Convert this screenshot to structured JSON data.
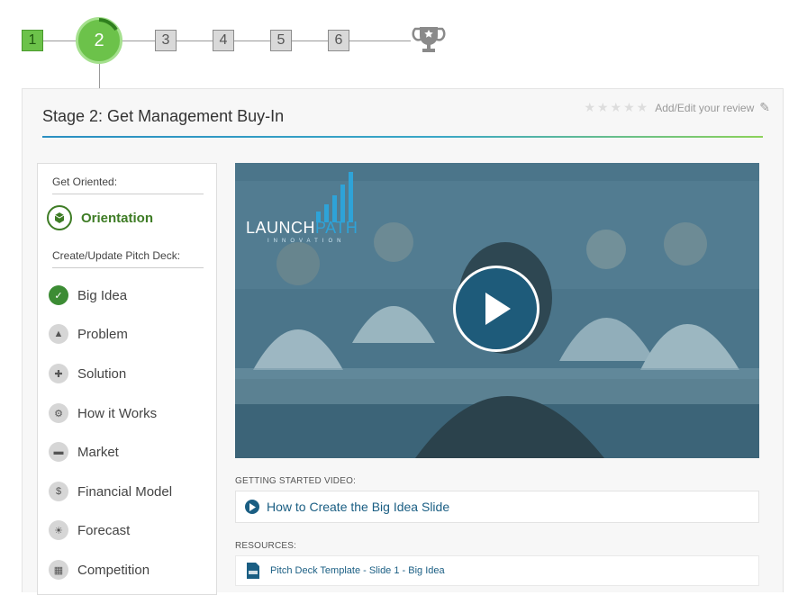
{
  "stepper": {
    "steps": [
      "1",
      "2",
      "3",
      "4",
      "5",
      "6"
    ],
    "current": "2",
    "trophy_icon": "trophy-icon"
  },
  "stage": {
    "title": "Stage 2: Get Management Buy-In",
    "review_label": "Add/Edit your review",
    "stars": "★★★★★"
  },
  "sidebar": {
    "heading_oriented": "Get Oriented:",
    "orientation": "Orientation",
    "heading_pitch": "Create/Update Pitch Deck:",
    "items": [
      {
        "label": "Big Idea",
        "icon": "✓"
      },
      {
        "label": "Problem",
        "icon": "▲"
      },
      {
        "label": "Solution",
        "icon": "✚"
      },
      {
        "label": "How it Works",
        "icon": "⚙"
      },
      {
        "label": "Market",
        "icon": "▬"
      },
      {
        "label": "Financial Model",
        "icon": "$"
      },
      {
        "label": "Forecast",
        "icon": "☀"
      },
      {
        "label": "Competition",
        "icon": "▦"
      }
    ]
  },
  "video": {
    "logo_launch": "LAUNCH",
    "logo_path": "PATH",
    "logo_sub": "INNOVATION",
    "section_label": "GETTING STARTED VIDEO:",
    "link_label": "How to Create the Big Idea Slide"
  },
  "resources": {
    "section_label": "RESOURCES:",
    "link_label": "Pitch Deck Template - Slide 1 - Big Idea"
  },
  "colors": {
    "accent_green": "#6cc24a",
    "accent_blue": "#1a5e83",
    "check_green": "#3c8c34"
  }
}
